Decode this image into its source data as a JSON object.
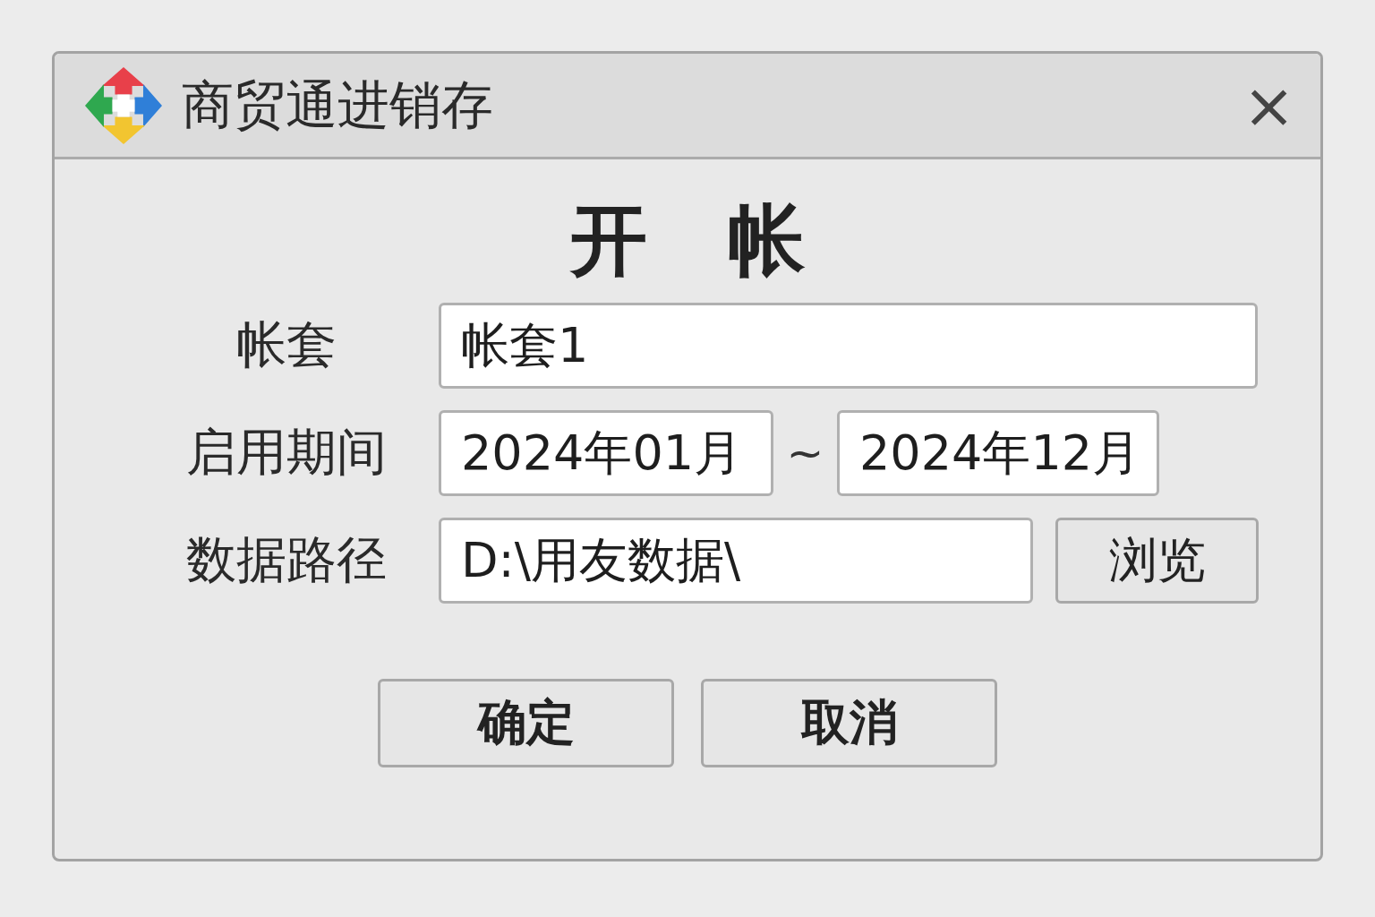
{
  "window": {
    "title": "商贸通进销存",
    "close": "×"
  },
  "heading": "开 帐",
  "rows": [
    {
      "kind": "single",
      "label": "帐套",
      "fields": [
        {
          "value": "帐套1"
        }
      ]
    },
    {
      "kind": "range",
      "label": "启用期间",
      "fields": [
        {
          "value": "2024年01月"
        },
        {
          "value": "2024年12月"
        }
      ],
      "separator": "~"
    },
    {
      "kind": "browse",
      "label": "数据路径",
      "fields": [
        {
          "value": "D:\\用友数据\\"
        }
      ],
      "button": "浏览"
    }
  ],
  "buttons": [
    "确定",
    "取消"
  ]
}
